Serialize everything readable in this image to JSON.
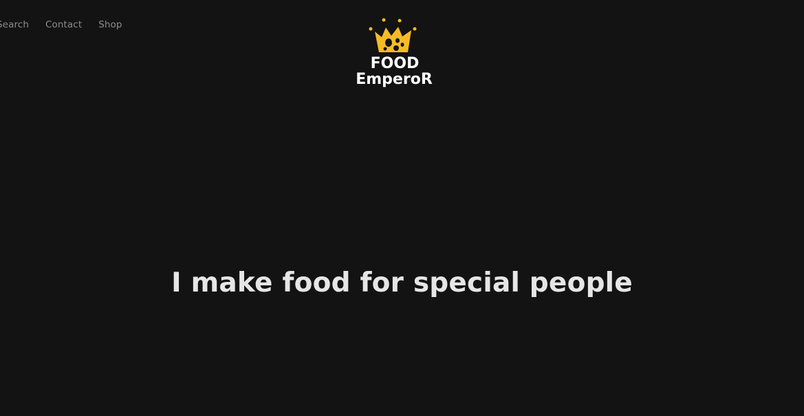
{
  "nav": {
    "items": [
      {
        "label": "Search"
      },
      {
        "label": "Contact"
      },
      {
        "label": "Shop"
      }
    ]
  },
  "logo": {
    "line1": "FOOD",
    "line2": "EmperoR",
    "icon": "crown-icon",
    "accent_color": "#f6bb27"
  },
  "hero": {
    "headline": "I make food for special people"
  },
  "colors": {
    "background": "#131313",
    "nav_text": "#8c8c8c",
    "headline_text": "#e6e6e6"
  }
}
